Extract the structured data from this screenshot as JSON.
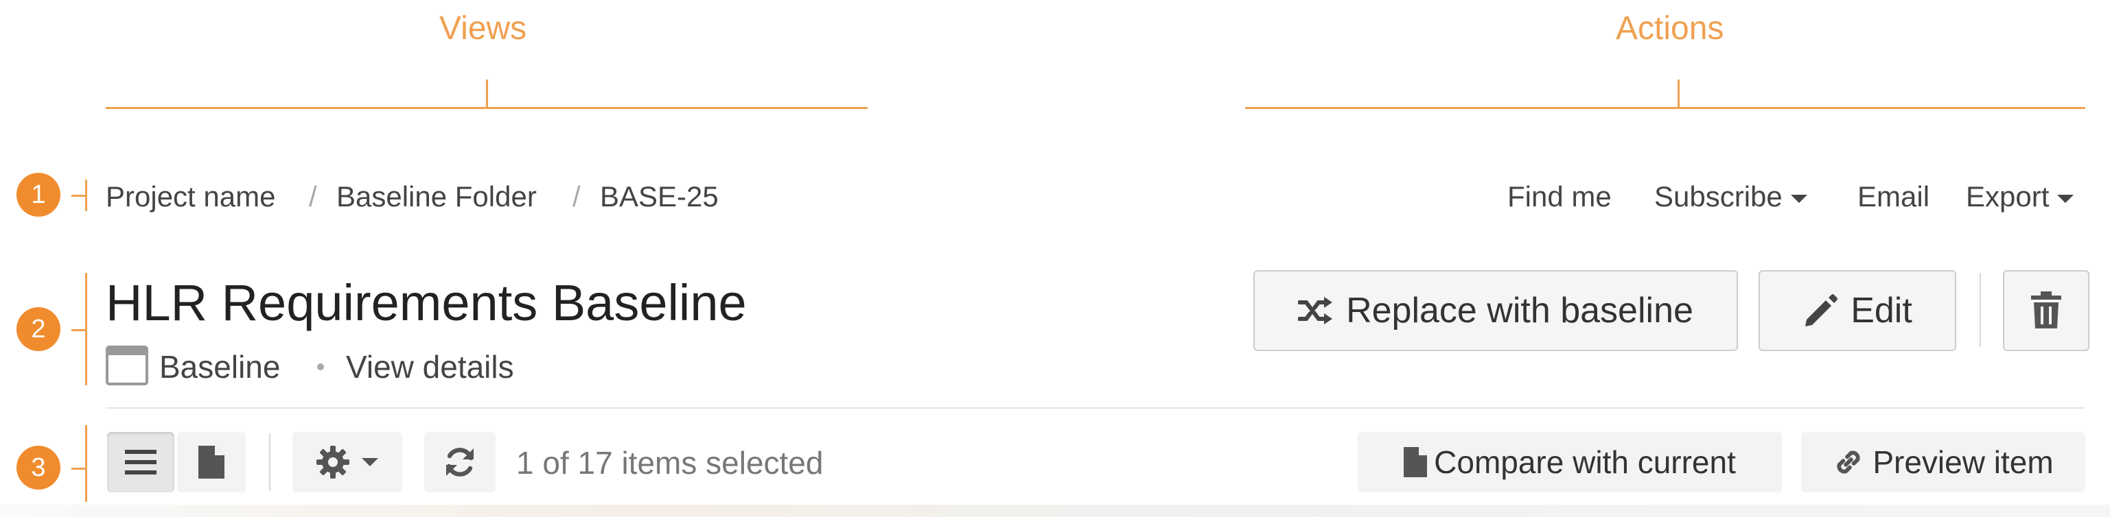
{
  "annotations": {
    "views_label": "Views",
    "actions_label": "Actions",
    "markers": [
      "1",
      "2",
      "3"
    ]
  },
  "breadcrumb": {
    "items": [
      "Project name",
      "Baseline Folder",
      "BASE-25"
    ],
    "separator": "/"
  },
  "top_actions": {
    "find_me": "Find me",
    "subscribe": "Subscribe",
    "email": "Email",
    "export": "Export"
  },
  "header": {
    "title": "HLR Requirements Baseline",
    "type_label": "Baseline",
    "view_details": "View details"
  },
  "action_buttons": {
    "replace": "Replace with baseline",
    "edit": "Edit"
  },
  "toolbar": {
    "selection_status": "1 of 17 items selected",
    "compare": "Compare with current",
    "preview": "Preview item"
  },
  "colors": {
    "annotation": "#f0a050",
    "marker": "#f08c2d",
    "text": "#444444",
    "button_bg": "#f5f5f5",
    "button_border": "#cccccc"
  },
  "icons": {
    "marker": "numbered-circle",
    "replace": "shuffle-icon",
    "edit": "pencil-icon",
    "delete": "trash-icon",
    "list_view": "list-icon",
    "document_view": "document-icon",
    "settings": "gear-icon",
    "refresh": "refresh-icon",
    "compare": "document-icon",
    "preview": "link-icon",
    "baseline_type": "window-icon"
  }
}
